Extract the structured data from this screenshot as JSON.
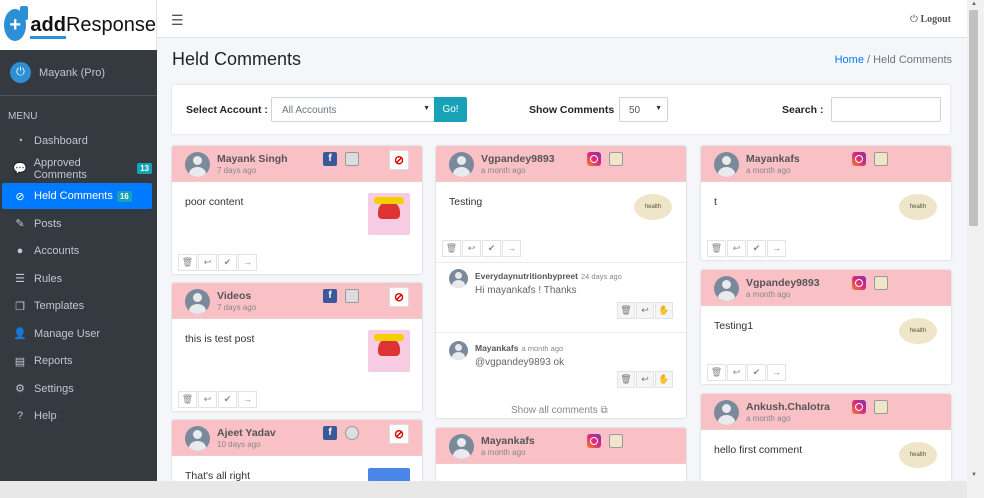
{
  "app": {
    "brand_prefix": "add",
    "brand_suffix": "Response",
    "user": "Mayank (Pro)",
    "menu_header": "MENU",
    "logout": "Logout"
  },
  "nav": [
    {
      "label": "Dashboard",
      "icon": "tachometer-icon"
    },
    {
      "label": "Approved Comments",
      "icon": "comments-icon",
      "badge": "13"
    },
    {
      "label": "Held Comments",
      "icon": "eye-slash-icon",
      "badge": "16",
      "active": true
    },
    {
      "label": "Posts",
      "icon": "edit-icon"
    },
    {
      "label": "Accounts",
      "icon": "user-circle-icon"
    },
    {
      "label": "Rules",
      "icon": "list-icon"
    },
    {
      "label": "Templates",
      "icon": "clone-icon"
    },
    {
      "label": "Manage User",
      "icon": "user-plus-icon"
    },
    {
      "label": "Reports",
      "icon": "archive-icon"
    },
    {
      "label": "Settings",
      "icon": "cogs-icon"
    },
    {
      "label": "Help",
      "icon": "question-circle-icon"
    }
  ],
  "page": {
    "title": "Held Comments",
    "crumb_home": "Home",
    "crumb_sep": "/",
    "crumb_current": "Held Comments"
  },
  "filter": {
    "account_label": "Select Account :",
    "account_value": "All Accounts",
    "go": "Go!",
    "show_label": "Show Comments",
    "show_value": "50",
    "search_label": "Search :",
    "search_value": ""
  },
  "col1": [
    {
      "name": "Mayank Singh",
      "time": "7 days ago",
      "text": "poor content",
      "platform": "f"
    },
    {
      "name": "Videos",
      "time": "7 days ago",
      "text": "this is test post",
      "platform": "f"
    },
    {
      "name": "Ajeet Yadav",
      "time": "10 days ago",
      "text": "That's all right",
      "platform": "f"
    }
  ],
  "col2": {
    "main": {
      "name": "Vgpandey9893",
      "time": "a month ago",
      "text": "Testing",
      "image_label": "health"
    },
    "replies": [
      {
        "name": "Everydaynutritionbypreet",
        "time": "24 days ago",
        "text": "Hi mayankafs ! Thanks"
      },
      {
        "name": "Mayankafs",
        "time": "a month ago",
        "text": "@vgpandey9893 ok"
      }
    ],
    "show_all": "Show all comments",
    "next": {
      "name": "Mayankafs",
      "time": "a month ago"
    }
  },
  "col3": [
    {
      "name": "Mayankafs",
      "time": "a month ago",
      "text": "t",
      "image_label": "health"
    },
    {
      "name": "Vgpandey9893",
      "time": "a month ago",
      "text": "Testing1",
      "image_label": "health"
    },
    {
      "name": "Ankush.Chalotra",
      "time": "a month ago",
      "text": "hello first comment",
      "image_label": "health"
    }
  ],
  "colors": {
    "accent": "#007bff",
    "sidebar": "#343a40",
    "card_header": "#f9c0c6",
    "go_button": "#17a2b8"
  }
}
